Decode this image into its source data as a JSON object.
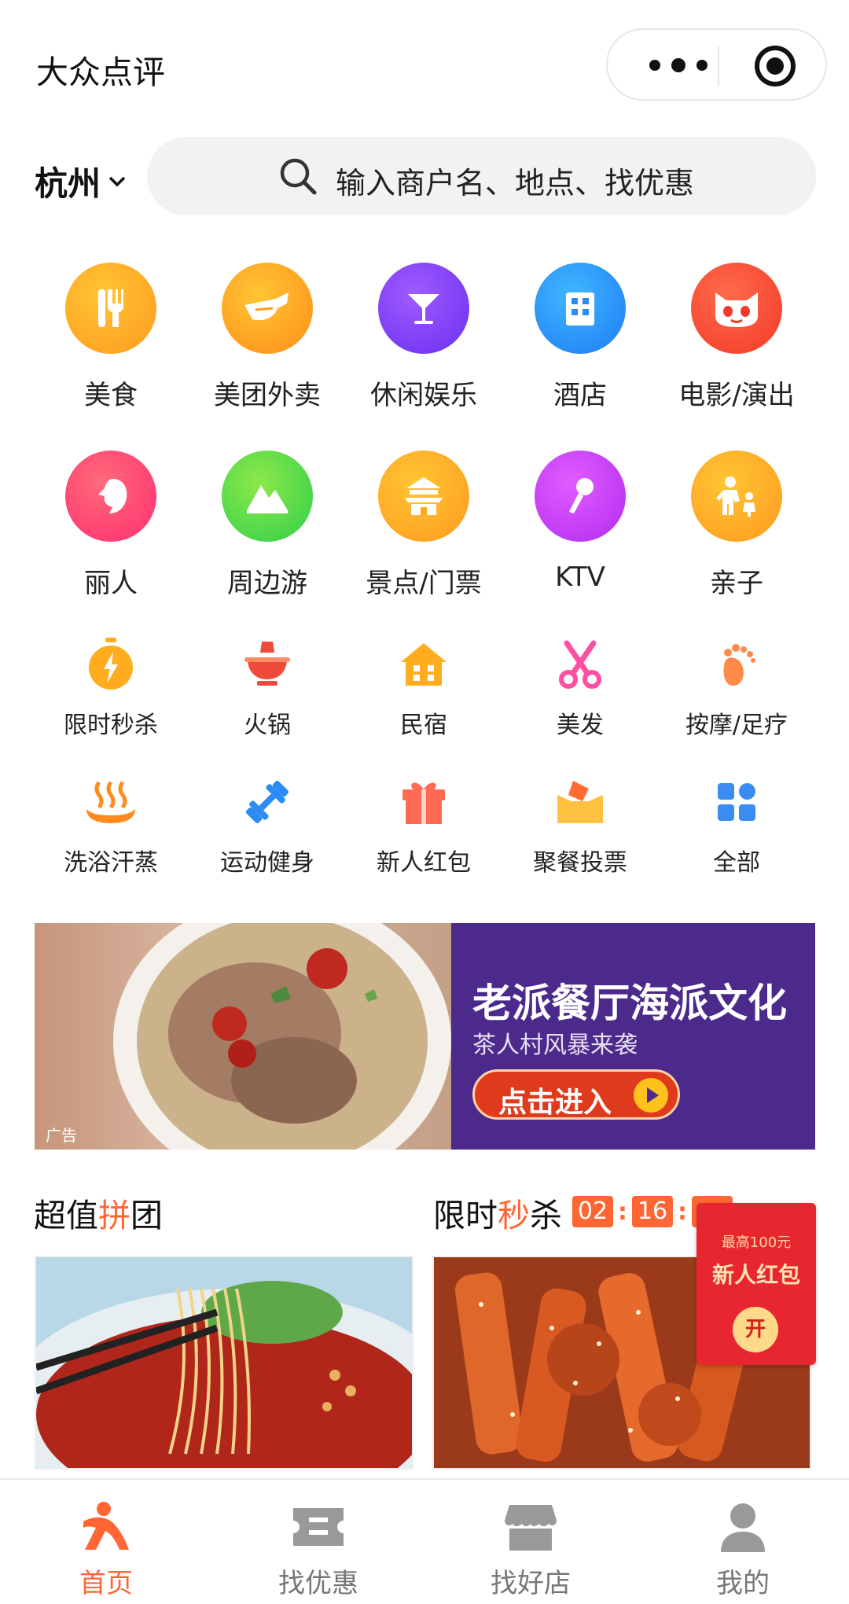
{
  "header": {
    "title": "大众点评"
  },
  "location": {
    "city": "杭州"
  },
  "search": {
    "placeholder": "输入商户名、地点、找优惠"
  },
  "main_categories": [
    {
      "label": "美食",
      "icon": "fork-knife-icon"
    },
    {
      "label": "美团外卖",
      "icon": "kangaroo-icon"
    },
    {
      "label": "休闲娱乐",
      "icon": "cocktail-glass-icon"
    },
    {
      "label": "酒店",
      "icon": "building-icon"
    },
    {
      "label": "电影/演出",
      "icon": "cat-face-icon"
    },
    {
      "label": "丽人",
      "icon": "woman-profile-icon"
    },
    {
      "label": "周边游",
      "icon": "mountain-icon"
    },
    {
      "label": "景点/门票",
      "icon": "temple-icon"
    },
    {
      "label": "KTV",
      "icon": "microphone-icon"
    },
    {
      "label": "亲子",
      "icon": "parent-child-icon"
    }
  ],
  "sub_categories": [
    {
      "label": "限时秒杀",
      "icon": "stopwatch-bolt-icon"
    },
    {
      "label": "火锅",
      "icon": "hotpot-icon"
    },
    {
      "label": "民宿",
      "icon": "house-icon"
    },
    {
      "label": "美发",
      "icon": "scissors-icon"
    },
    {
      "label": "按摩/足疗",
      "icon": "footprint-icon"
    },
    {
      "label": "洗浴汗蒸",
      "icon": "hot-spring-icon"
    },
    {
      "label": "运动健身",
      "icon": "dumbbell-icon"
    },
    {
      "label": "新人红包",
      "icon": "gift-icon"
    },
    {
      "label": "聚餐投票",
      "icon": "ballot-box-icon"
    },
    {
      "label": "全部",
      "icon": "grid-icon"
    }
  ],
  "banner": {
    "title": "老派餐厅海派文化",
    "subtitle": "茶人村风暴来袭",
    "cta": "点击进入",
    "ad_tag": "广告"
  },
  "group_buy": {
    "title_pre": "超值",
    "title_hl": "拼",
    "title_post": "团"
  },
  "flash_sale": {
    "title_pre": "限时",
    "title_hl": "秒",
    "title_post": "杀",
    "hours": "02",
    "minutes": "16"
  },
  "red_packet": {
    "top": "最高100元",
    "title": "新人红包",
    "open": "开"
  },
  "tabs": [
    {
      "label": "首页",
      "icon": "dianping-logo-icon",
      "active": true
    },
    {
      "label": "找优惠",
      "icon": "coupon-icon",
      "active": false
    },
    {
      "label": "找好店",
      "icon": "storefront-icon",
      "active": false
    },
    {
      "label": "我的",
      "icon": "user-icon",
      "active": false
    }
  ],
  "colors": {
    "accent": "#ff6633",
    "red_packet": "#e8262f",
    "banner_purple": "#4b2a8c"
  }
}
